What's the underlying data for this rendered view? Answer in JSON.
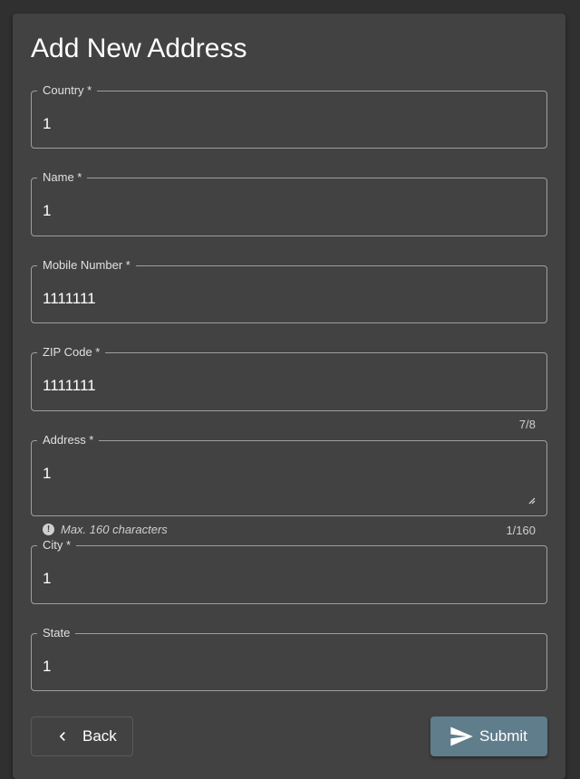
{
  "page": {
    "title": "Add New Address"
  },
  "fields": {
    "country": {
      "label": "Country *",
      "value": "1"
    },
    "name": {
      "label": "Name *",
      "value": "1"
    },
    "mobile": {
      "label": "Mobile Number *",
      "value": "1111111"
    },
    "zip": {
      "label": "ZIP Code *",
      "value": "1111111",
      "counter": "7/8"
    },
    "address": {
      "label": "Address *",
      "value": "1",
      "hint": "Max. 160 characters",
      "counter": "1/160"
    },
    "city": {
      "label": "City *",
      "value": "1"
    },
    "state": {
      "label": "State",
      "value": "1"
    }
  },
  "buttons": {
    "back_label": "Back",
    "submit_label": "Submit"
  },
  "icons": {
    "back": "chevron-left-icon",
    "submit": "send-icon",
    "hint": "exclamation-circle-icon",
    "resize": "resize-handle-icon"
  },
  "colors": {
    "background": "#303030",
    "card": "#424242",
    "submit_button": "#607d8b",
    "outline": "#9e9e9e"
  }
}
